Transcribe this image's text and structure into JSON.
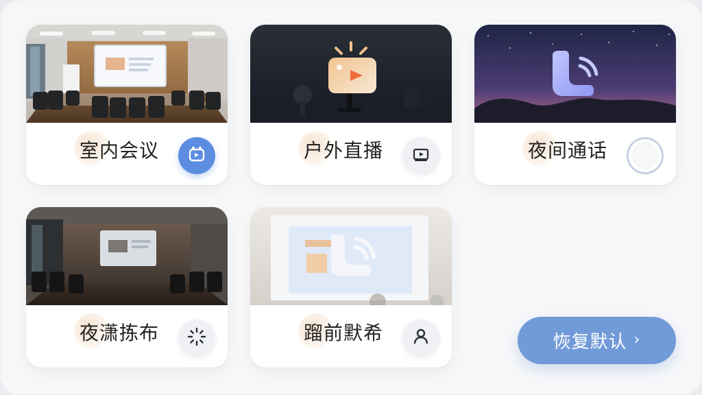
{
  "scenes": [
    {
      "label": "室内会议",
      "image": "indoor-conference-room",
      "action_icon": "indoor-meeting-icon",
      "action_style": "accent"
    },
    {
      "label": "户外直播",
      "image": "outdoor-live-stage",
      "action_icon": "video-play-icon",
      "action_style": "soft"
    },
    {
      "label": "夜间通话",
      "image": "night-sky-call",
      "action_icon": "empty-radio-icon",
      "action_style": "ring"
    },
    {
      "label": "夜潇拣布",
      "image": "dark-conference-room",
      "action_icon": "loading-spinner-icon",
      "action_style": "soft"
    },
    {
      "label": "蹓前默希",
      "image": "projector-screen",
      "action_icon": "user-icon",
      "action_style": "soft"
    }
  ],
  "reset_button": {
    "label": "恢复默认",
    "chevron": "›"
  },
  "colors": {
    "accent": "#5d8de0",
    "button": "#719ad9",
    "panel": "#f6f7f9"
  }
}
